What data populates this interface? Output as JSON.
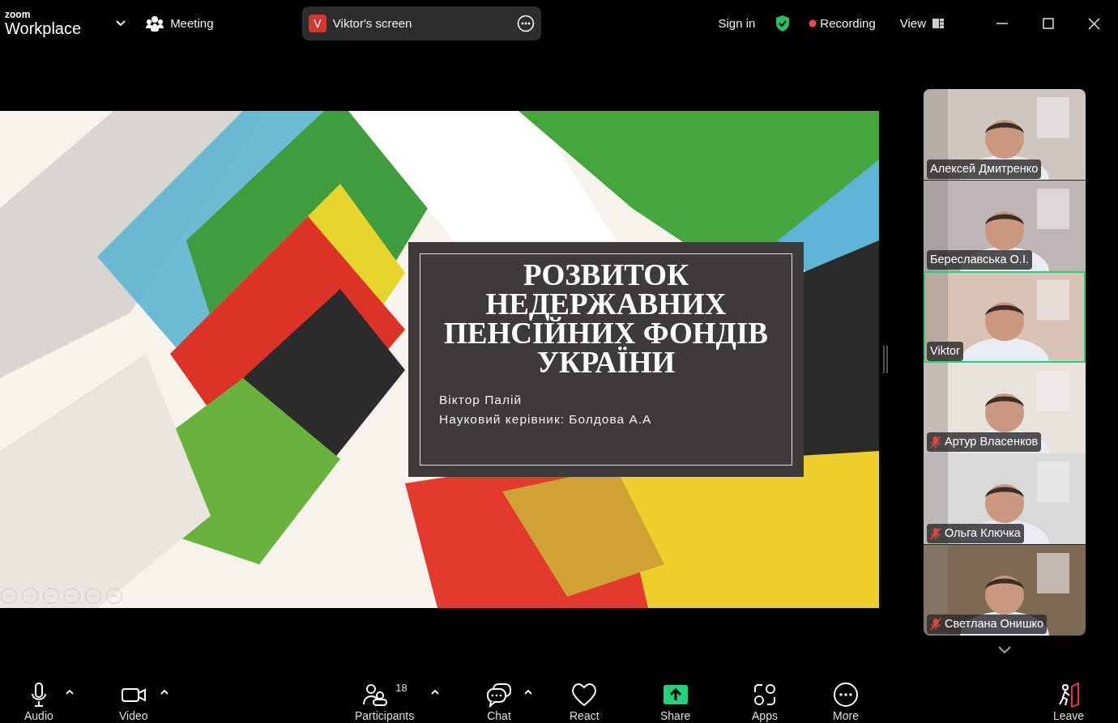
{
  "top_bar": {
    "brand_small": "zoom",
    "brand_large": "Workplace",
    "meeting_label": "Meeting",
    "share_pill": {
      "avatar_letter": "V",
      "label": "Viktor's screen"
    },
    "sign_in": "Sign in",
    "recording": "Recording",
    "view": "View"
  },
  "slide": {
    "title": "РОЗВИТОК НЕДЕРЖАВНИХ ПЕНСІЙНИХ ФОНДІВ УКРАЇНИ",
    "lines": [
      "Віктор Палій",
      "Науковий керівник: Болдова А.А"
    ]
  },
  "participants": [
    {
      "name": "Алексей Дмитренко",
      "muted": false,
      "speaking": false
    },
    {
      "name": "Береславська О.І.",
      "muted": false,
      "speaking": false
    },
    {
      "name": "Viktor",
      "muted": false,
      "speaking": true
    },
    {
      "name": "Артур Власенков",
      "muted": true,
      "speaking": false
    },
    {
      "name": "Ольга Ключка",
      "muted": true,
      "speaking": false
    },
    {
      "name": "Светлана Онишко",
      "muted": true,
      "speaking": false
    }
  ],
  "toolbar": [
    {
      "kind": "audio",
      "label": "Audio",
      "caret": true
    },
    {
      "kind": "video",
      "label": "Video",
      "caret": true
    },
    {
      "kind": "participants",
      "label": "Participants",
      "count": "18",
      "caret": true
    },
    {
      "kind": "chat",
      "label": "Chat",
      "caret": true
    },
    {
      "kind": "react",
      "label": "React",
      "caret": false
    },
    {
      "kind": "share",
      "label": "Share",
      "caret": false
    },
    {
      "kind": "apps",
      "label": "Apps",
      "caret": false
    },
    {
      "kind": "more",
      "label": "More",
      "caret": false
    },
    {
      "kind": "leave",
      "label": "Leave",
      "caret": false
    }
  ]
}
